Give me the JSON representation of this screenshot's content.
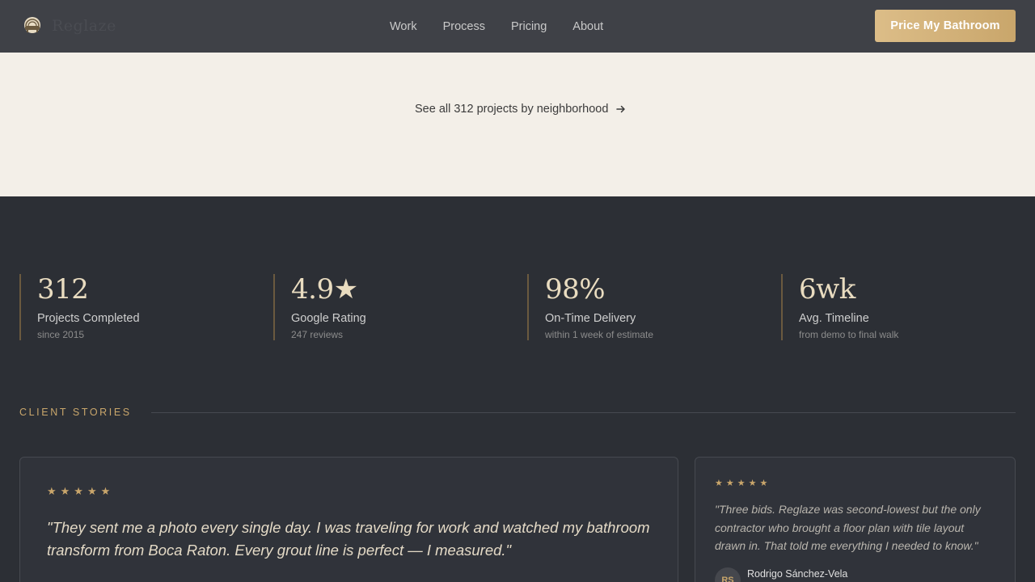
{
  "nav": {
    "brand": "Reglaze",
    "links": [
      "Work",
      "Process",
      "Pricing",
      "About"
    ],
    "cta_label": "Price My Bathroom"
  },
  "projects": {
    "see_all_label": "See all 312 projects by neighborhood"
  },
  "stats": [
    {
      "value": "312",
      "label": "Projects Completed",
      "sub": "since 2015"
    },
    {
      "value": "4.9★",
      "label": "Google Rating",
      "sub": "247 reviews"
    },
    {
      "value": "98%",
      "label": "On-Time Delivery",
      "sub": "within 1 week of estimate"
    },
    {
      "value": "6wk",
      "label": "Avg. Timeline",
      "sub": "from demo to final walk"
    }
  ],
  "stories": {
    "heading": "CLIENT STORIES",
    "cards": [
      {
        "stars": "★★★★★",
        "quote": "\"They sent me a photo every single day. I was traveling for work and watched my bathroom transform from Boca Raton. Every grout line is perfect — I measured.\""
      },
      {
        "stars": "★★★★★",
        "quote": "\"Three bids. Reglaze was second-lowest but the only contractor who brought a floor plan with tile layout drawn in. That told me everything I needed to know.\"",
        "author_initials": "RS",
        "author_name": "Rodrigo Sánchez-Vela"
      }
    ]
  },
  "colors": {
    "accent": "#c9a66b",
    "nav_bg": "#3f4147",
    "light_band": "#f3efe8",
    "dark_bg": "#2c2f35"
  }
}
